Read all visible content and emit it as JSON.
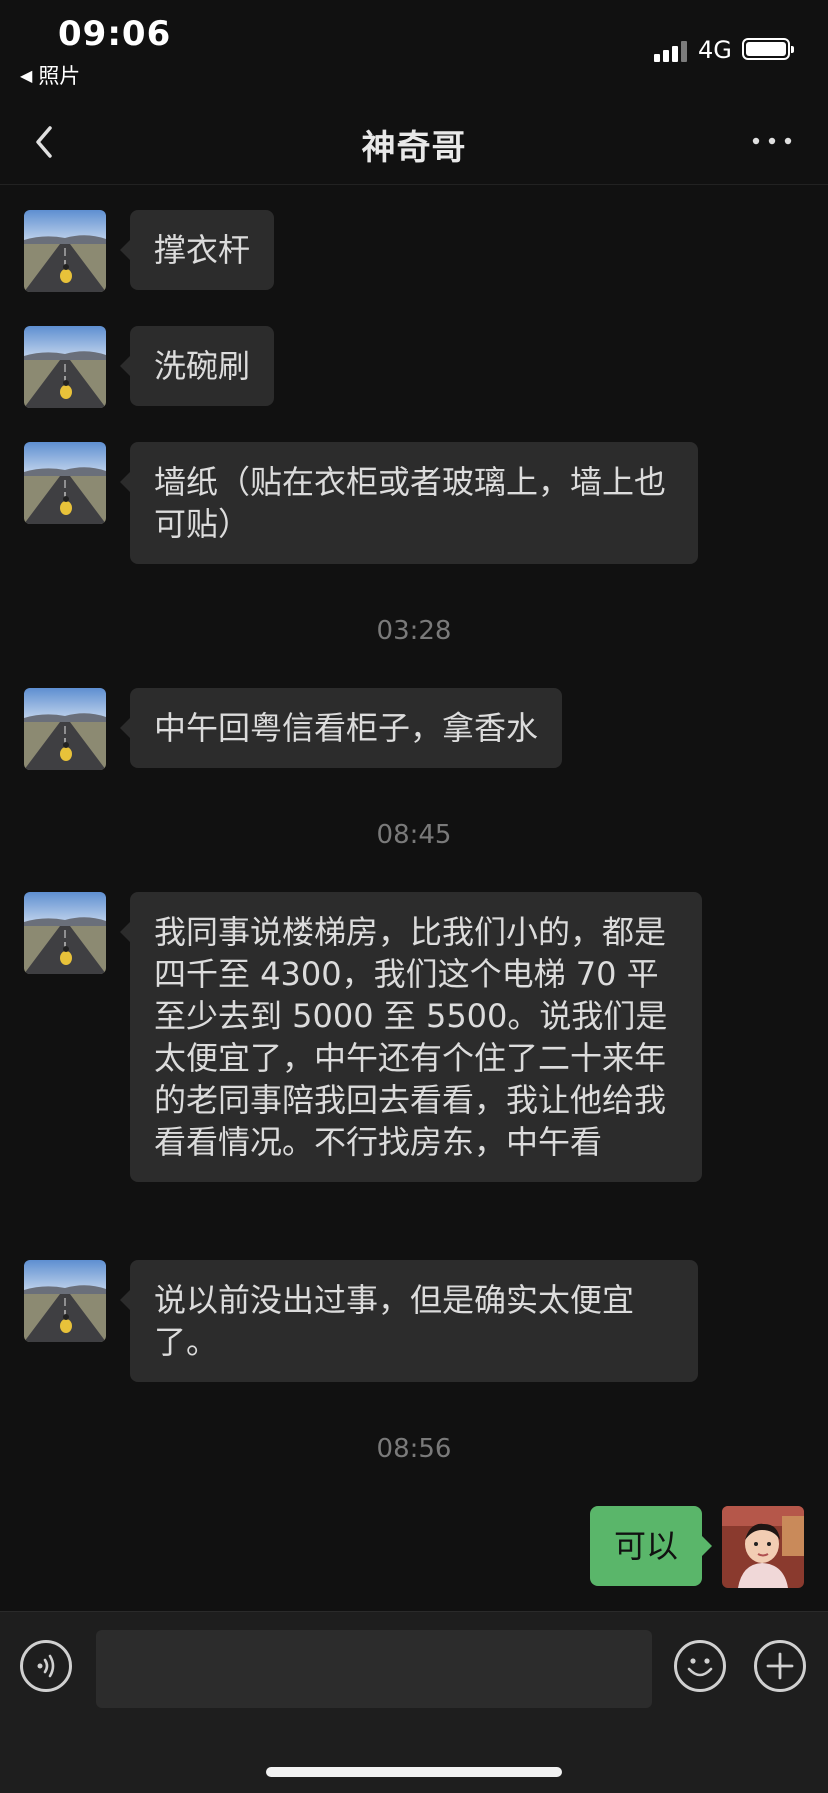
{
  "status_bar": {
    "time": "09:06",
    "back_app_label": "照片",
    "network": "4G"
  },
  "nav": {
    "title": "神奇哥"
  },
  "messages": [
    {
      "side": "left",
      "text": "撑衣杆"
    },
    {
      "side": "left",
      "text": "洗碗刷"
    },
    {
      "side": "left",
      "text": "墙纸（贴在衣柜或者玻璃上，墙上也可贴）"
    },
    {
      "type": "timestamp",
      "text": "03:28"
    },
    {
      "side": "left",
      "text": "中午回粤信看柜子，拿香水"
    },
    {
      "type": "timestamp",
      "text": "08:45"
    },
    {
      "side": "left",
      "text": "我同事说楼梯房，比我们小的，都是四千至 4300，我们这个电梯 70 平至少去到 5000 至 5500。说我们是太便宜了，中午还有个住了二十来年的老同事陪我回去看看，我让他给我看看情况。不行找房东，中午看"
    },
    {
      "side": "left",
      "text": "说以前没出过事，但是确实太便宜了。"
    },
    {
      "type": "timestamp",
      "text": "08:56"
    },
    {
      "side": "right",
      "text": "可以"
    }
  ],
  "input": {
    "value": ""
  },
  "colors": {
    "background": "#111111",
    "bubble_other": "#2c2c2c",
    "bubble_me": "#5ab66a",
    "timestamp": "#7a7a7a"
  },
  "icons": {
    "voice": "voice-icon",
    "emoji": "emoji-icon",
    "plus": "plus-icon",
    "back": "chevron-left-icon",
    "more": "more-icon"
  }
}
